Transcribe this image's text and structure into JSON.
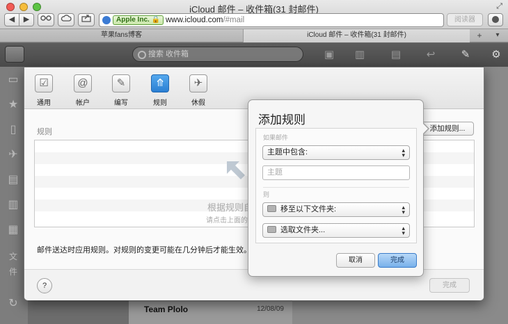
{
  "browser": {
    "window_title": "iCloud 邮件 – 收件箱(31 封邮件)",
    "nav_back": "◀",
    "nav_forward": "▶",
    "ev_badge": "Apple Inc.",
    "url_host": "www.icloud.com",
    "url_hash": "/#mail",
    "reader_label": "阅读器",
    "tabs": [
      {
        "label": "苹果fans博客"
      },
      {
        "label": "iCloud 邮件 – 收件箱(31 封邮件)"
      }
    ],
    "new_tab_symbol": "+"
  },
  "mail": {
    "search_placeholder": "搜索 收件箱",
    "sidebar_partial_label": "文件",
    "bottom_row": {
      "sender": "Team Plolo",
      "date": "12/08/09"
    }
  },
  "prefs": {
    "tabs": [
      {
        "label": "通用",
        "icon": "checkbox-icon"
      },
      {
        "label": "帐户",
        "icon": "at-sign-icon"
      },
      {
        "label": "编写",
        "icon": "compose-icon"
      },
      {
        "label": "规则",
        "icon": "rules-icon",
        "active": true
      },
      {
        "label": "休假",
        "icon": "airplane-icon"
      }
    ],
    "rules_label": "规则",
    "rules_empty_title": "根据规则自",
    "rules_empty_hint": "请点击上面的",
    "add_rule_button": "添加规则...",
    "footnote": "邮件送达时应用规则。对规则的变更可能在几分钟后才能生效。",
    "help_button": "?",
    "done_button": "完成"
  },
  "add_rule_popover": {
    "title": "添加规则",
    "if_label": "如果邮件",
    "condition_select": "主题中包含:",
    "subject_placeholder": "主题",
    "then_label": "则",
    "action_select": "移至以下文件夹:",
    "folder_select": "选取文件夹...",
    "cancel_button": "取消",
    "done_button": "完成"
  },
  "colors": {
    "accent_blue": "#2b7fd3",
    "primary_button": "#77b0ea",
    "overlay_dark": "#6d6d6d"
  }
}
